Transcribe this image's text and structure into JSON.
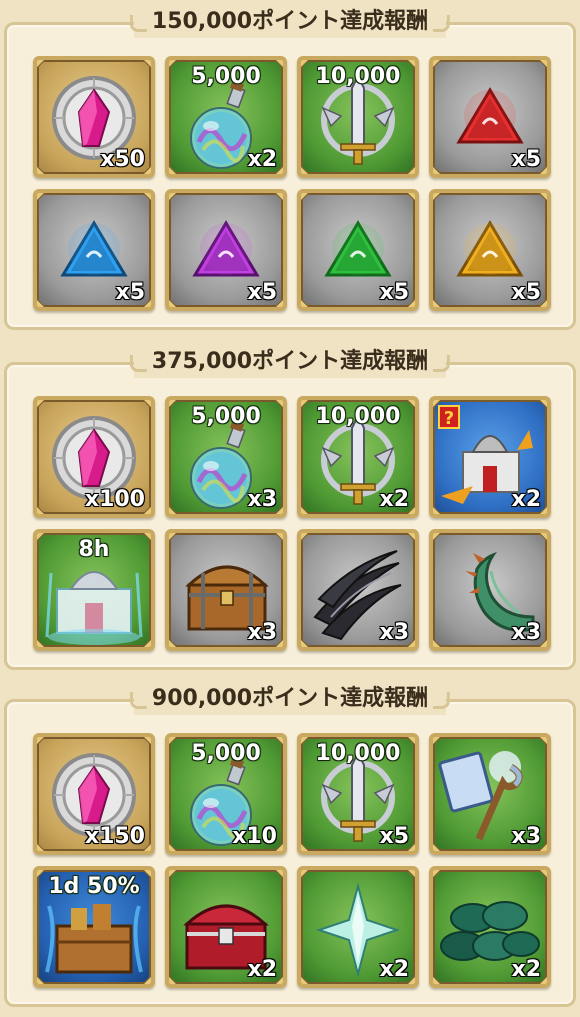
{
  "sections": [
    {
      "title": "150,000ポイント達成報酬",
      "items": [
        {
          "icon": "crystal-medallion-icon",
          "bg": "gold",
          "top": "",
          "qty": "x50"
        },
        {
          "icon": "potion-flask-icon",
          "bg": "green",
          "top": "5,000",
          "qty": "x2"
        },
        {
          "icon": "sword-emblem-icon",
          "bg": "green",
          "top": "10,000",
          "qty": ""
        },
        {
          "icon": "red-rune-gem-icon",
          "bg": "gray",
          "top": "",
          "qty": "x5"
        },
        {
          "icon": "blue-rune-gem-icon",
          "bg": "gray",
          "top": "",
          "qty": "x5"
        },
        {
          "icon": "purple-rune-gem-icon",
          "bg": "gray",
          "top": "",
          "qty": "x5"
        },
        {
          "icon": "green-rune-gem-icon",
          "bg": "gray",
          "top": "",
          "qty": "x5"
        },
        {
          "icon": "yellow-rune-gem-icon",
          "bg": "gray",
          "top": "",
          "qty": "x5"
        }
      ]
    },
    {
      "title": "375,000ポイント達成報酬",
      "items": [
        {
          "icon": "crystal-medallion-icon",
          "bg": "gold",
          "top": "",
          "qty": "x100"
        },
        {
          "icon": "potion-flask-icon",
          "bg": "green",
          "top": "5,000",
          "qty": "x3"
        },
        {
          "icon": "sword-emblem-icon",
          "bg": "green",
          "top": "10,000",
          "qty": "x2"
        },
        {
          "icon": "castle-upgrade-icon",
          "bg": "blue",
          "top": "",
          "qty": "x2"
        },
        {
          "icon": "castle-timer-icon",
          "bg": "green",
          "top": "8h",
          "qty": ""
        },
        {
          "icon": "wooden-chest-icon",
          "bg": "gray",
          "top": "",
          "qty": "x3"
        },
        {
          "icon": "claws-icon",
          "bg": "gray",
          "top": "",
          "qty": "x3"
        },
        {
          "icon": "dragon-tail-icon",
          "bg": "gray",
          "top": "",
          "qty": "x3"
        }
      ]
    },
    {
      "title": "900,000ポイント達成報酬",
      "items": [
        {
          "icon": "crystal-medallion-icon",
          "bg": "gold",
          "top": "",
          "qty": "x150"
        },
        {
          "icon": "potion-flask-icon",
          "bg": "green",
          "top": "5,000",
          "qty": "x10"
        },
        {
          "icon": "sword-emblem-icon",
          "bg": "green",
          "top": "10,000",
          "qty": "x5"
        },
        {
          "icon": "card-and-staff-icon",
          "bg": "green",
          "top": "",
          "qty": "x3"
        },
        {
          "icon": "supply-crate-icon",
          "bg": "darkblue",
          "top": "1d 50%",
          "qty": ""
        },
        {
          "icon": "red-chest-icon",
          "bg": "green",
          "top": "",
          "qty": "x2"
        },
        {
          "icon": "crystal-star-icon",
          "bg": "green",
          "top": "",
          "qty": "x2"
        },
        {
          "icon": "dragon-scales-icon",
          "bg": "green",
          "top": "",
          "qty": "x2"
        }
      ]
    }
  ]
}
